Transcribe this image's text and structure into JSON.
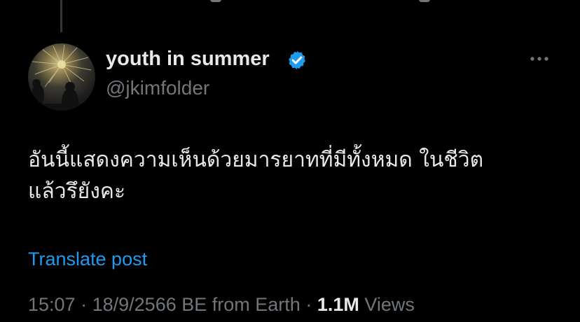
{
  "author": {
    "display_name": "youth in summer",
    "handle": "@jkimfolder",
    "verified": true
  },
  "post": {
    "text_lines": [
      "อันนี้แสดงความเห็นด้วยมารยาทที่มีทั้งหมด ในชีวิต",
      "แล้วรึยังคะ"
    ],
    "translate_label": "Translate post"
  },
  "meta": {
    "time": "15:07",
    "separator": "·",
    "date": "18/9/2566 BE",
    "source": "from Earth",
    "views_count": "1.1M",
    "views_label": "Views"
  },
  "colors": {
    "background": "#000000",
    "text_primary": "#e7e9ea",
    "text_secondary": "#71767b",
    "accent": "#1d9bf0"
  },
  "icons": {
    "verified": "verified-badge-icon",
    "more": "more-options-icon"
  }
}
